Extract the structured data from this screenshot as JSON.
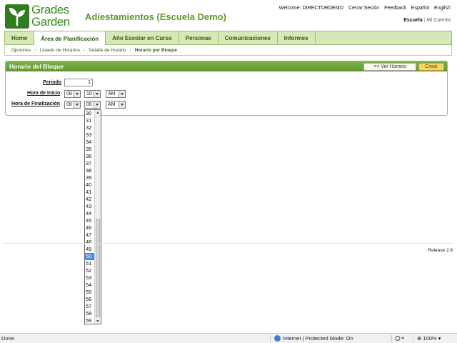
{
  "header": {
    "logo_line1": "Grades",
    "logo_line2": "Garden",
    "school_title": "Adiestamientos (Escuela Demo)",
    "top_links": [
      "Welcome: DIRECTORDEMO",
      "Cerrar Sesión",
      "Feedback",
      "Español",
      "English"
    ],
    "scope_active": "Escuela",
    "scope_inactive": "Mi Cuenta"
  },
  "nav": {
    "items": [
      "Home",
      "Área de Planificación",
      "Año Escolar en Curso",
      "Personas",
      "Comunicaciones",
      "Informes"
    ],
    "active_index": 1
  },
  "breadcrumb": [
    "Opciones",
    "Listado de Horarios",
    "Detalle de Horario",
    "Horario por Bloque"
  ],
  "panel": {
    "title": "Horario del Bloque",
    "view_button": "<< Ver Horario",
    "create_button": "Crear",
    "period_label": "Periodo",
    "period_value": "1",
    "start_label": "Hora de Inicio",
    "start_hour": "08",
    "start_minute": "10",
    "start_ampm": "AM",
    "end_label": "Hora de Finalización",
    "end_hour": "08",
    "end_minute": "00",
    "end_ampm": "AM"
  },
  "minute_dropdown": {
    "options": [
      "30",
      "31",
      "32",
      "33",
      "34",
      "35",
      "36",
      "37",
      "38",
      "39",
      "40",
      "41",
      "42",
      "43",
      "44",
      "45",
      "46",
      "47",
      "48",
      "49",
      "50",
      "51",
      "52",
      "53",
      "54",
      "55",
      "56",
      "57",
      "58",
      "59"
    ],
    "highlighted": "50"
  },
  "footer": {
    "release": "Release 2.8"
  },
  "statusbar": {
    "left": "Done",
    "zone": "Internet | Protected Mode: On",
    "zoom": "100%"
  },
  "colors": {
    "brand_green": "#3f8a23",
    "nav_bg": "#d6e8b8",
    "panel_header": "#6fa63d",
    "create_button": "#f4d56b",
    "highlight": "#3a8ee6"
  }
}
